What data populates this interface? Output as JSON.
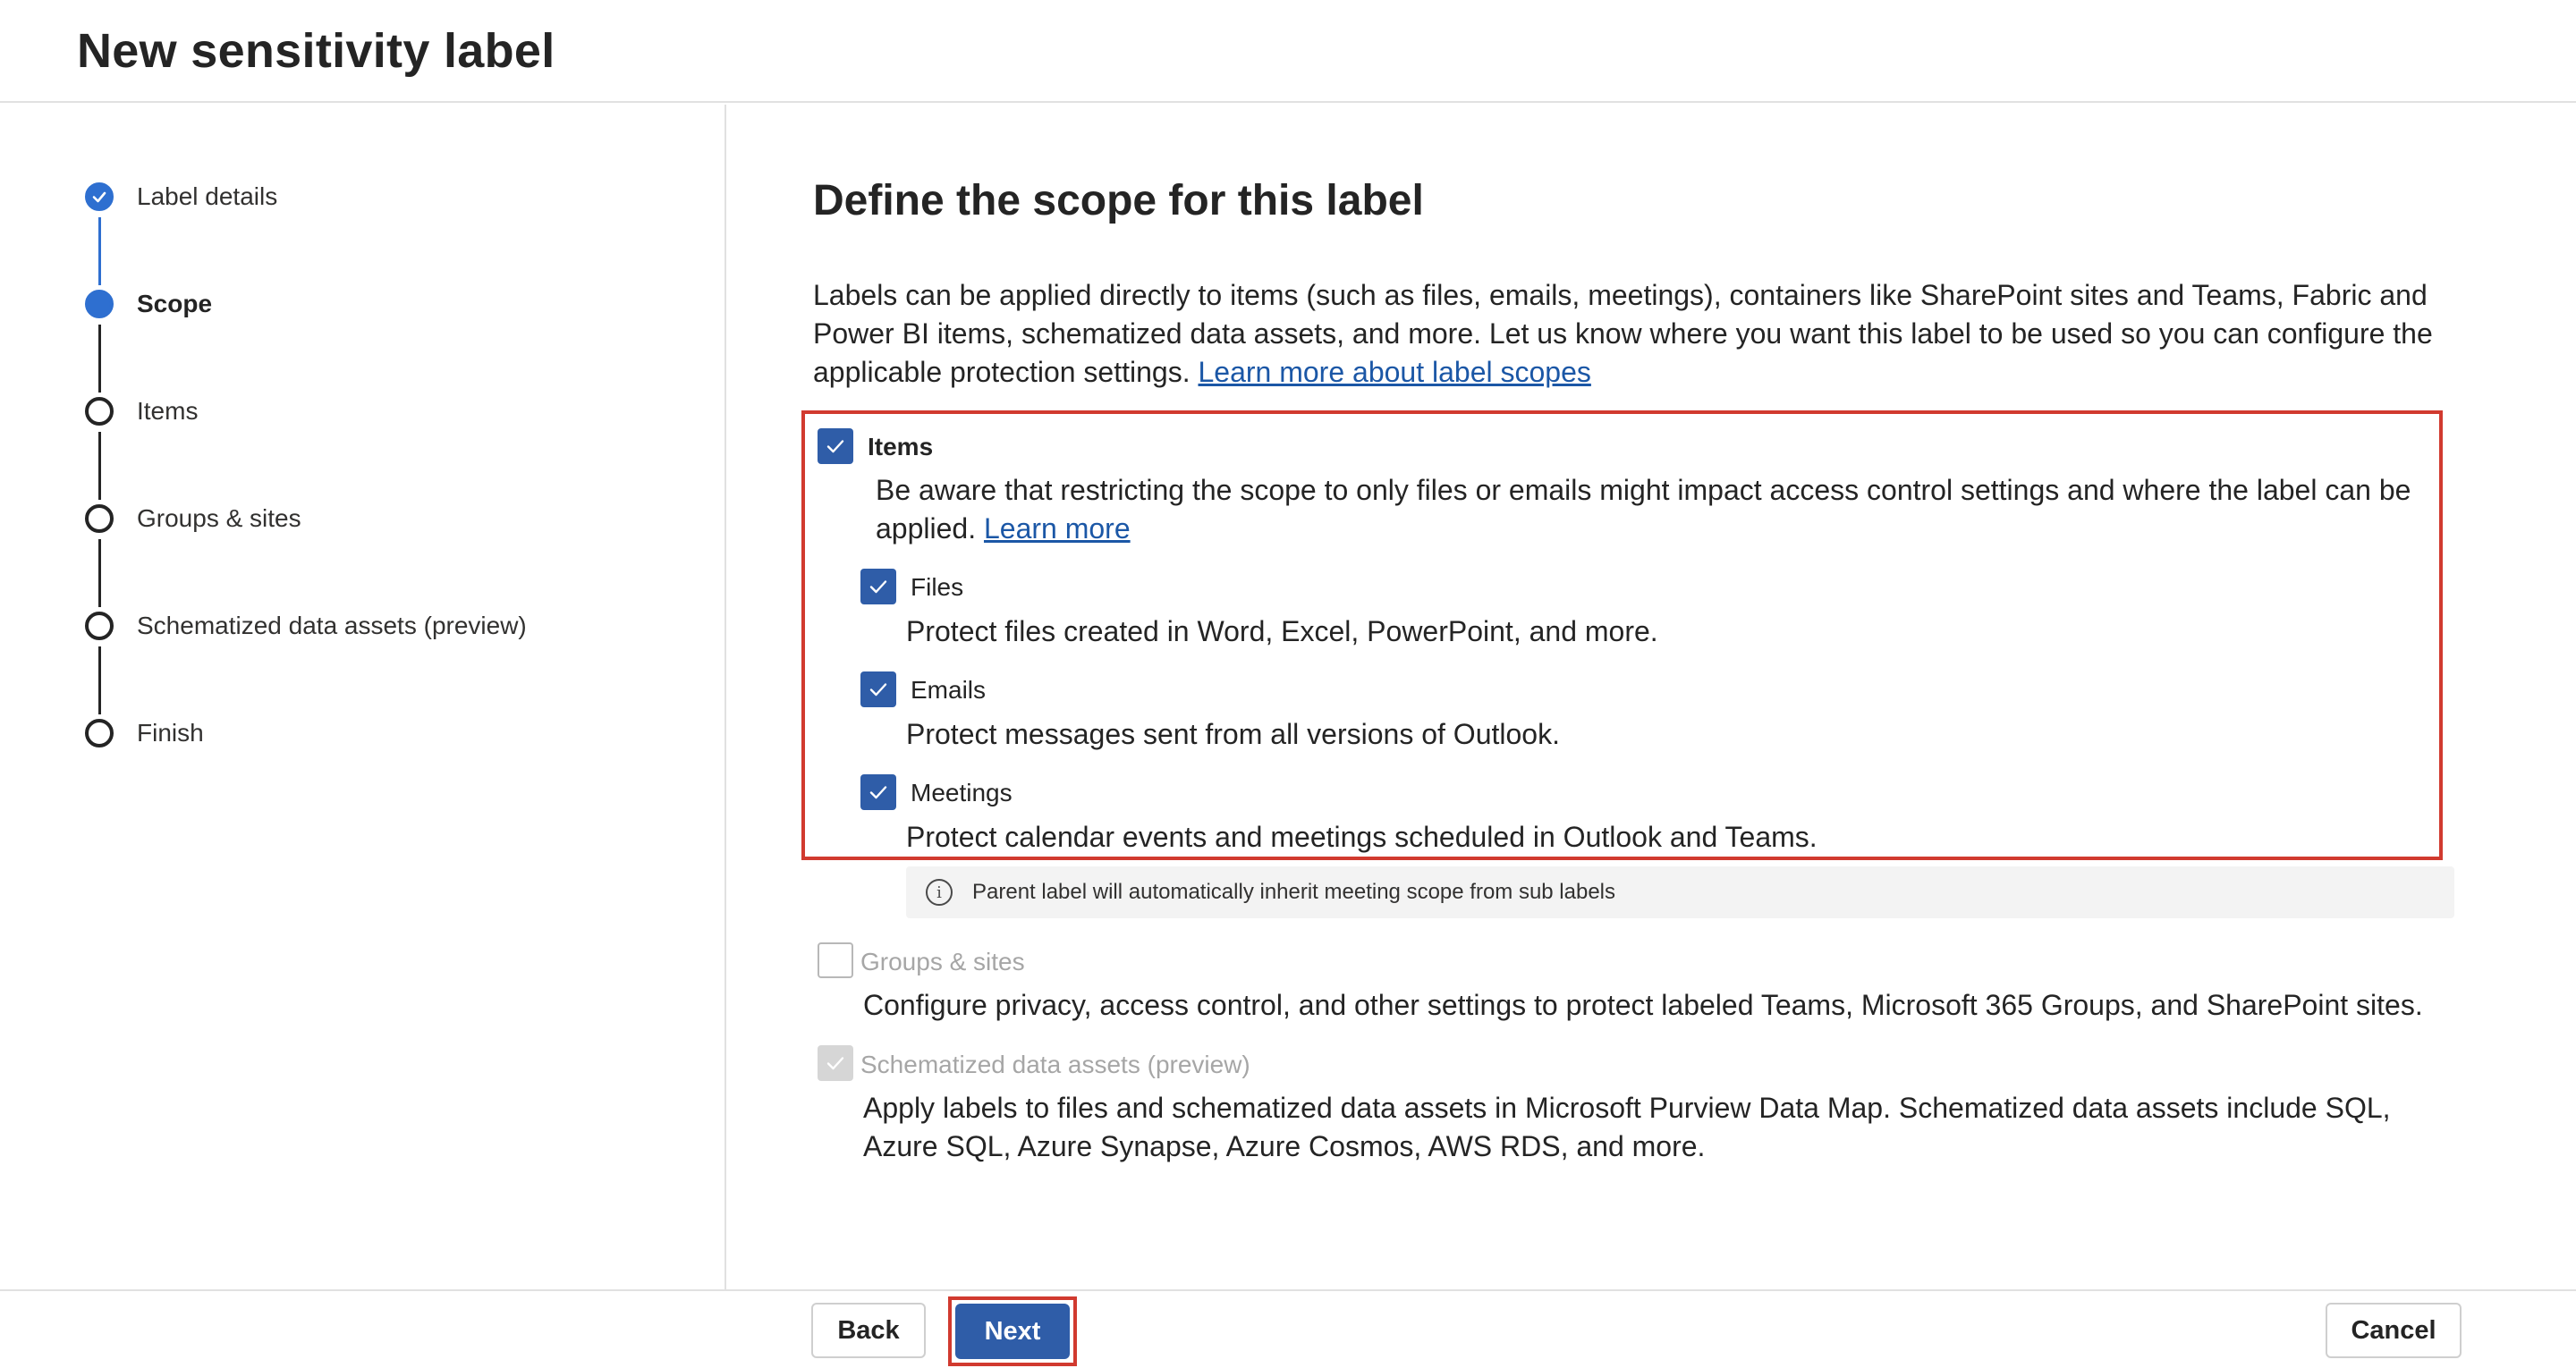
{
  "header": {
    "title": "New sensitivity label"
  },
  "steps": [
    {
      "label": "Label details",
      "state": "done"
    },
    {
      "label": "Scope",
      "state": "current"
    },
    {
      "label": "Items",
      "state": "todo"
    },
    {
      "label": "Groups & sites",
      "state": "todo"
    },
    {
      "label": "Schematized data assets (preview)",
      "state": "todo"
    },
    {
      "label": "Finish",
      "state": "todo"
    }
  ],
  "main": {
    "title": "Define the scope for this label",
    "description": "Labels can be applied directly to items (such as files, emails, meetings), containers like SharePoint sites and Teams, Fabric and Power BI items, schematized data assets, and more. Let us know where you want this label to be used so you can configure the applicable protection settings.",
    "description_link": "Learn more about label scopes",
    "items": {
      "label": "Items",
      "checked": true,
      "description": "Be aware that restricting the scope to only files or emails might impact access control settings and where the label can be applied.",
      "link": "Learn more",
      "files": {
        "label": "Files",
        "checked": true,
        "description": "Protect files created in Word, Excel, PowerPoint, and more."
      },
      "emails": {
        "label": "Emails",
        "checked": true,
        "description": "Protect messages sent from all versions of Outlook."
      },
      "meetings": {
        "label": "Meetings",
        "checked": true,
        "description": "Protect calendar events and meetings scheduled in Outlook and Teams."
      }
    },
    "info": "Parent label will automatically inherit meeting scope from sub labels",
    "groups": {
      "label": "Groups & sites",
      "checked": false,
      "disabled": true,
      "description": "Configure privacy, access control, and other settings to protect labeled Teams, Microsoft 365 Groups, and SharePoint sites."
    },
    "schematized": {
      "label": "Schematized data assets (preview)",
      "checked": true,
      "disabled": true,
      "description": "Apply labels to files and schematized data assets in Microsoft Purview Data Map. Schematized data assets include SQL, Azure SQL, Azure Synapse, Azure Cosmos, AWS RDS, and more."
    }
  },
  "footer": {
    "back": "Back",
    "next": "Next",
    "cancel": "Cancel"
  },
  "colors": {
    "accent": "#2f5da8",
    "step_accent": "#2e6fd0",
    "highlight": "#d13a2f",
    "link": "#1b57a6"
  }
}
